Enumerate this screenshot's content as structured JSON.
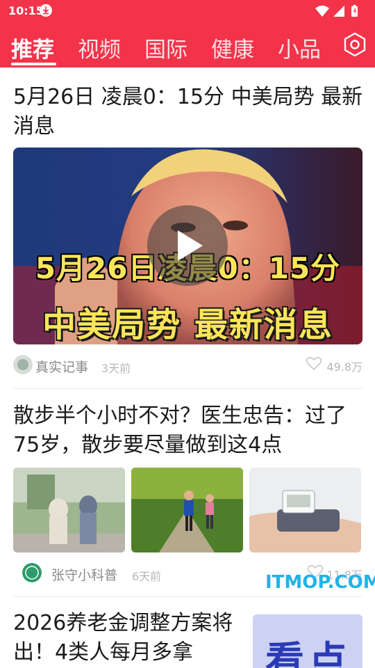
{
  "status_bar": {
    "time": "10:15"
  },
  "tabs": [
    {
      "label": "推荐",
      "active": true
    },
    {
      "label": "视频"
    },
    {
      "label": "国际"
    },
    {
      "label": "健康"
    },
    {
      "label": "小品"
    }
  ],
  "feed": {
    "item1": {
      "title": "5月26日 凌晨0：15分 中美局势 最新消息",
      "video_caption_line1": "5月26日凌晨0：15分",
      "video_caption_line2": "中美局势  最新消息",
      "author": "真实记事",
      "time": "3天前",
      "likes": "49.8万"
    },
    "item2": {
      "title": "散步半个小时不对？医生忠告：过了75岁，散步要尽量做到这4点",
      "author": "张守小科普",
      "time": "6天前",
      "likes": "11.8万"
    },
    "item3": {
      "title": "2026养老金调整方案将出！4类人每月多拿",
      "thumb_text": "看点"
    }
  },
  "watermark": "ITMOP.COM",
  "colors": {
    "brand_red": "#f3334a",
    "text_dark": "#1b1b1b",
    "meta_gray": "#8a8a8a"
  }
}
